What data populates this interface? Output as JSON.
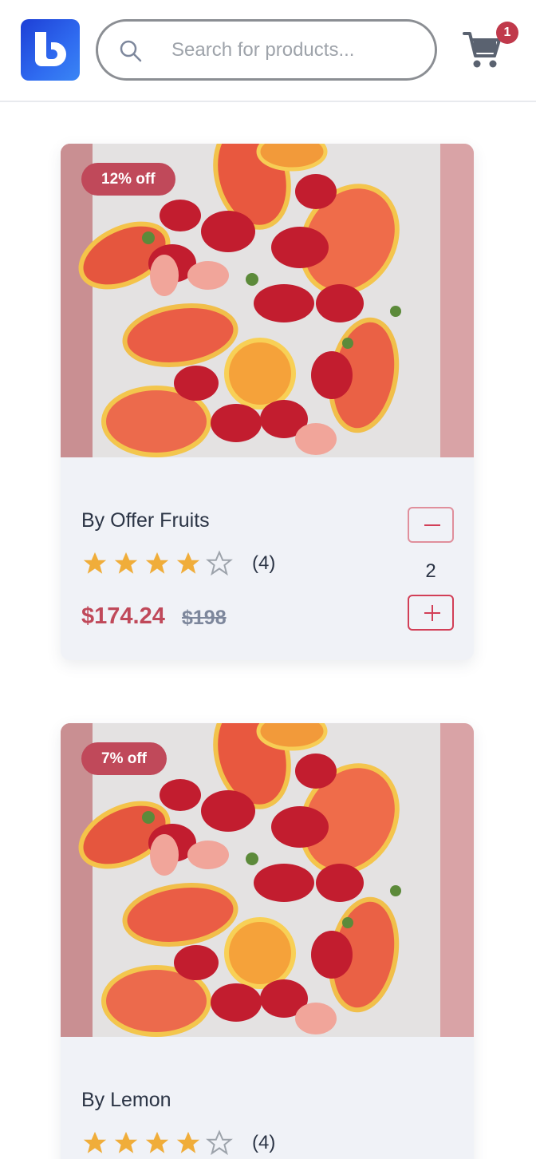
{
  "header": {
    "logo_letter": "B",
    "search": {
      "placeholder": "Search for products...",
      "value": ""
    },
    "cart": {
      "icon": "cart-icon",
      "count": "1"
    }
  },
  "products": [
    {
      "discount": "12% off",
      "title": "By Offer Fruits",
      "rating": 4,
      "rating_max": 5,
      "rating_count": "(4)",
      "price": "$174.24",
      "old_price": "$198",
      "quantity": "2"
    },
    {
      "discount": "7% off",
      "title": "By Lemon",
      "rating": 4,
      "rating_max": 5,
      "rating_count": "(4)"
    }
  ],
  "colors": {
    "accent": "#c0495a",
    "star_filled": "#f0ad3a",
    "star_empty": "#9da3ab",
    "card_bg": "#f0f2f7",
    "logo_blue": "#1d3fd6"
  }
}
